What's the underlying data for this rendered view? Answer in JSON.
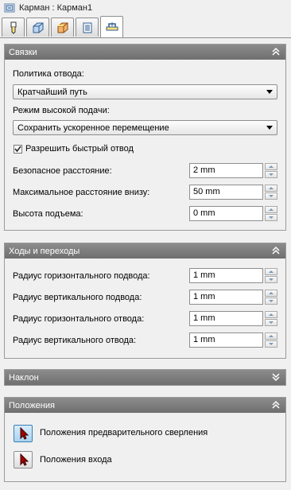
{
  "window": {
    "title": "Карман : Карман1"
  },
  "tabs": [
    {
      "icon": "tool-icon"
    },
    {
      "icon": "shape-icon"
    },
    {
      "icon": "heights-icon"
    },
    {
      "icon": "passes-icon"
    },
    {
      "icon": "linking-icon",
      "active": true
    }
  ],
  "linking": {
    "title": "Связки",
    "retract_policy_label": "Политика отвода:",
    "retract_policy_value": "Кратчайший путь",
    "high_feed_label": "Режим высокой подачи:",
    "high_feed_value": "Сохранить ускоренное перемещение",
    "allow_rapid_retract_label": "Разрешить быстрый отвод",
    "allow_rapid_retract_checked": true,
    "safe_distance_label": "Безопасное расстояние:",
    "safe_distance_value": "2 mm",
    "max_stay_down_label": "Максимальное расстояние внизу:",
    "max_stay_down_value": "50 mm",
    "lift_height_label": "Высота подъема:",
    "lift_height_value": "0 mm"
  },
  "leads": {
    "title": "Ходы и переходы",
    "h_lead_in_label": "Радиус горизонтального подвода:",
    "h_lead_in_value": "1 mm",
    "v_lead_in_label": "Радиус вертикального подвода:",
    "v_lead_in_value": "1 mm",
    "h_lead_out_label": "Радиус горизонтального отвода:",
    "h_lead_out_value": "1 mm",
    "v_lead_out_label": "Радиус вертикального отвода:",
    "v_lead_out_value": "1 mm"
  },
  "ramp": {
    "title": "Наклон"
  },
  "positions": {
    "title": "Положения",
    "predrill_label": "Положения предварительного сверления",
    "entry_label": "Положения входа"
  },
  "colors": {
    "header": "#7d7d7d",
    "accent": "#3c7fb1",
    "pointer": "#a00000"
  }
}
